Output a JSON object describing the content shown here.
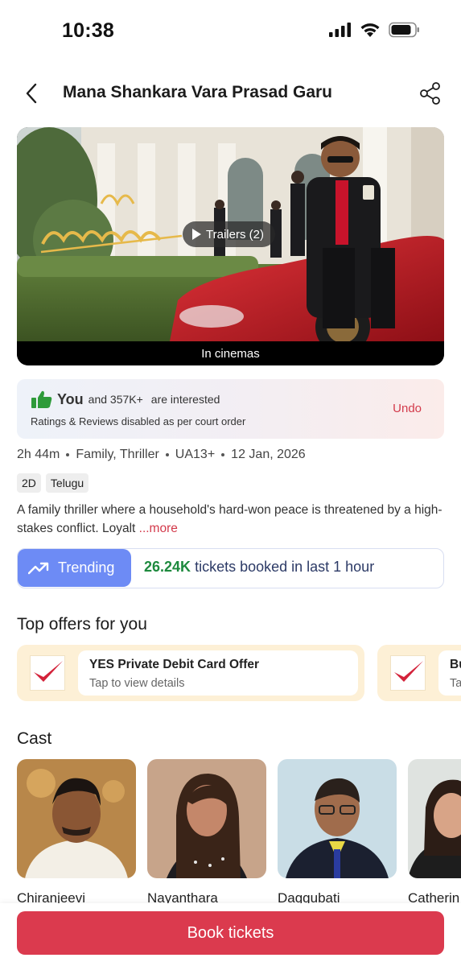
{
  "status_bar": {
    "time": "10:38",
    "icons": [
      "cellular-signal-icon",
      "wifi-icon",
      "battery-icon"
    ]
  },
  "header": {
    "title": "Mana Shankara Vara Prasad Garu",
    "back_icon": "back-arrow-icon",
    "share_icon": "share-icon"
  },
  "poster": {
    "trailer_label": "Trailers (2)",
    "status_label": "In cinemas"
  },
  "interest": {
    "you": "You",
    "count_text": "and 357K+",
    "rest": "are interested",
    "note": "Ratings & Reviews disabled as per court order",
    "undo_label": "Undo",
    "icon": "thumbs-up-icon",
    "icon_color": "#2e9b3a"
  },
  "meta": {
    "duration": "2h 44m",
    "genres": "Family, Thriller",
    "certificate": "UA13+",
    "release_date": "12 Jan, 2026",
    "tags": [
      "2D",
      "Telugu"
    ]
  },
  "description": {
    "text": "A family thriller where a household's hard-won peace is threatened by a high-stakes conflict. Loyalt",
    "more_label": "...more"
  },
  "trending": {
    "badge_label": "Trending",
    "count": "26.24K",
    "text": "tickets booked in last 1 hour",
    "badge_color": "#6d8bf5",
    "count_color": "#1e8a3e"
  },
  "offers": {
    "section_title": "Top offers for you",
    "items": [
      {
        "title": "YES Private Debit Card Offer",
        "subtitle": "Tap to view details"
      },
      {
        "title": "Bu",
        "subtitle": "Ta"
      }
    ]
  },
  "cast": {
    "section_title": "Cast",
    "members": [
      {
        "name": "Chiranjeevi"
      },
      {
        "name": "Nayanthara"
      },
      {
        "name": "Daggubati"
      },
      {
        "name": "Catherin"
      }
    ]
  },
  "footer": {
    "book_label": "Book tickets",
    "accent_color": "#db3a4e"
  }
}
